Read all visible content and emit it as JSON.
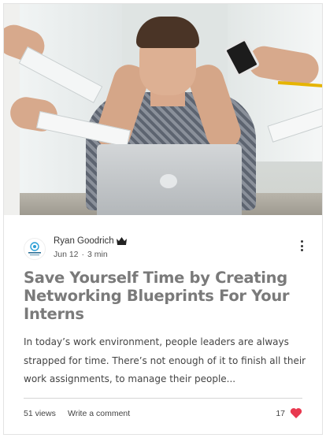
{
  "post": {
    "author_name": "Ryan Goodrich",
    "author_badge_icon": "crown-icon",
    "avatar_icon": "company-logo-icon",
    "date": "Jun 12",
    "separator": "·",
    "read_time": "3 min",
    "menu_icon": "more-options-icon",
    "title": "Save Yourself Time by Creating Networking Blueprints For Your Interns",
    "excerpt": "In today’s work environment, people leaders are always strapped for time. There’s not enough of it to finish all their work assignments, to manage their people...",
    "views": "51 views",
    "comment_label": "Write a comment",
    "likes": "17",
    "like_icon": "heart-icon"
  },
  "colors": {
    "title": "#7a7a7a",
    "heart": "#e8384f",
    "divider": "#d6d6d6"
  }
}
